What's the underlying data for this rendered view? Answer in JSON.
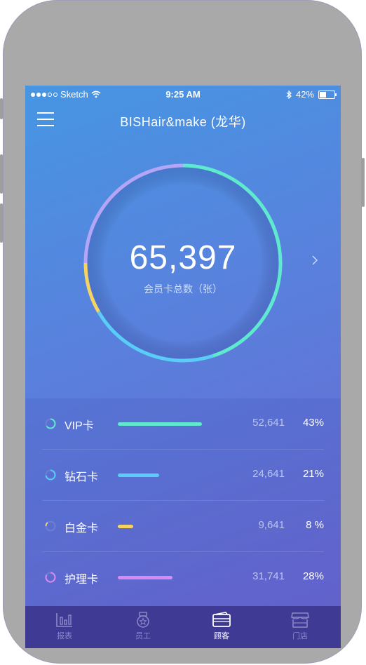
{
  "status_bar": {
    "carrier": "Sketch",
    "time": "9:25 AM",
    "battery": "42%"
  },
  "nav": {
    "title": "BISHair&make (龙华)"
  },
  "summary": {
    "total": "65,397",
    "label": "会员卡总数（张）"
  },
  "cards": [
    {
      "name": "VIP卡",
      "count": "52,641",
      "percent": "43%",
      "share": 0.43,
      "color": "#5fe9cf"
    },
    {
      "name": "钻石卡",
      "count": "24,641",
      "percent": "21%",
      "share": 0.21,
      "color": "#59cdf5"
    },
    {
      "name": "白金卡",
      "count": "9,641",
      "percent": "8 %",
      "share": 0.08,
      "color": "#f6d463"
    },
    {
      "name": "护理卡",
      "count": "31,741",
      "percent": "28%",
      "share": 0.28,
      "color": "#d88af0"
    }
  ],
  "ring_colors": {
    "vip": "#5fe9cf",
    "diamond": "#59cdf5",
    "platinum": "#f6d463",
    "care": "#b4a6f7"
  },
  "tabs": [
    {
      "label": "报表",
      "icon": "chart-bars-icon"
    },
    {
      "label": "员工",
      "icon": "badge-star-icon"
    },
    {
      "label": "顾客",
      "icon": "wallet-icon",
      "active": true
    },
    {
      "label": "门店",
      "icon": "store-icon"
    }
  ]
}
